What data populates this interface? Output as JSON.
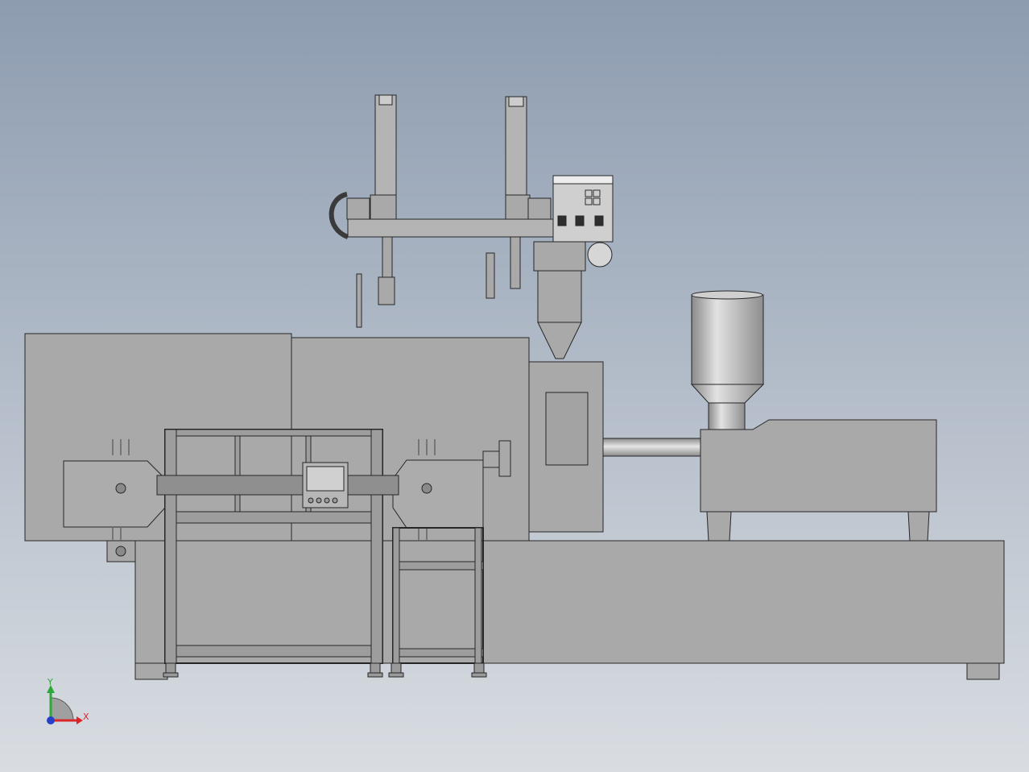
{
  "viewport": {
    "background_top": "#8d9cb0",
    "background_bottom": "#d9dde2",
    "model_fill": "#a9a9a9",
    "model_fill_light": "#bdbdbd",
    "model_edge": "#262626"
  },
  "triad": {
    "x_label": "X",
    "y_label": "Y",
    "x_color": "#d8262b",
    "y_color": "#2ea83a",
    "z_color": "#2640c8"
  }
}
